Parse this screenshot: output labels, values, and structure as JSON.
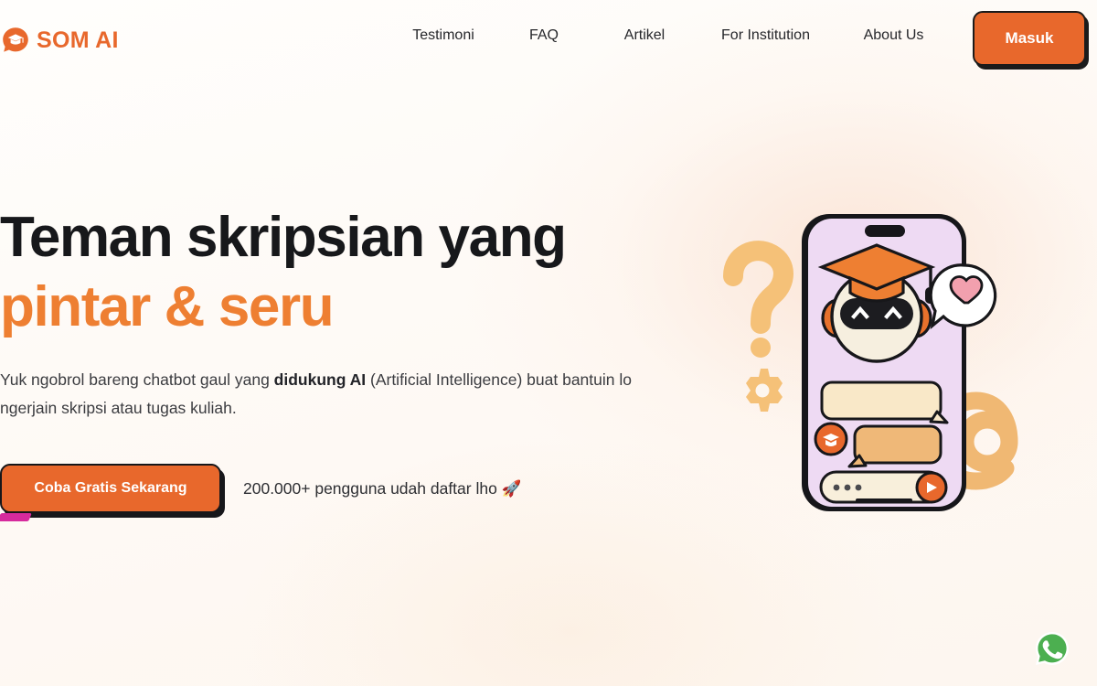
{
  "brand": {
    "name": "SOM AI",
    "icon": "graduation-cap-bubble-logo",
    "color": "#E8682C"
  },
  "header": {
    "nav_items": [
      {
        "label": "Testimoni"
      },
      {
        "label": "FAQ"
      },
      {
        "label": "Artikel"
      },
      {
        "label": "For Institution"
      },
      {
        "label": "About Us"
      }
    ],
    "login_button": {
      "label": "Masuk",
      "bg_color": "#E8682C",
      "text_color": "#FFFFFF",
      "border_color": "#1B1B1B"
    }
  },
  "hero": {
    "headline_line1": "Teman skripsian yang",
    "headline_line2": "pintar & seru",
    "headline_color": "#17181B",
    "headline_accent_color": "#EE7F32",
    "underline_color": "#D62A9D",
    "subcopy_part1": "Yuk ngobrol bareng chatbot gaul yang ",
    "subcopy_bold": "didukung AI",
    "subcopy_part2": " (Artificial Intelligence) buat bantuin lo ngerjain skripsi atau tugas kuliah.",
    "cta_button": {
      "label": "Coba Gratis Sekarang",
      "bg_color": "#E8682C",
      "text_color": "#FFFFFF",
      "border_color": "#17171A"
    },
    "social_proof": "200.000+ pengguna udah daftar lho 🚀"
  },
  "illustration": {
    "name": "chatbot-phone-illustration",
    "phone_screen_color": "#EEDAF3",
    "phone_frame_color": "#16161A",
    "robot": {
      "face_color": "#F6EFDF",
      "visor_color": "#1C1C20",
      "ear_color": "#E8712C",
      "cap_color": "#EE7F32",
      "eyes": "^ ^"
    },
    "heart_bubble": {
      "bubble_color": "#FFFFFF",
      "heart_color": "#F2A0AE"
    },
    "chat_bubbles": [
      {
        "role": "outgoing",
        "color": "#F9E8C8"
      },
      {
        "role": "incoming",
        "color": "#EFB878"
      }
    ],
    "input_bar": {
      "color": "#F8EFDB",
      "placeholder_dots": "• • •",
      "send_button_color": "#E8682C",
      "send_icon": "play-icon"
    },
    "decorations": [
      {
        "name": "question-mark-icon",
        "color": "#F5C178"
      },
      {
        "name": "gear-icon",
        "color": "#F5C178"
      },
      {
        "name": "at-symbol-icon",
        "color": "#F0B873"
      }
    ]
  },
  "floating_action": {
    "name": "whatsapp-button",
    "icon": "whatsapp-icon",
    "color": "#4CAF50"
  }
}
